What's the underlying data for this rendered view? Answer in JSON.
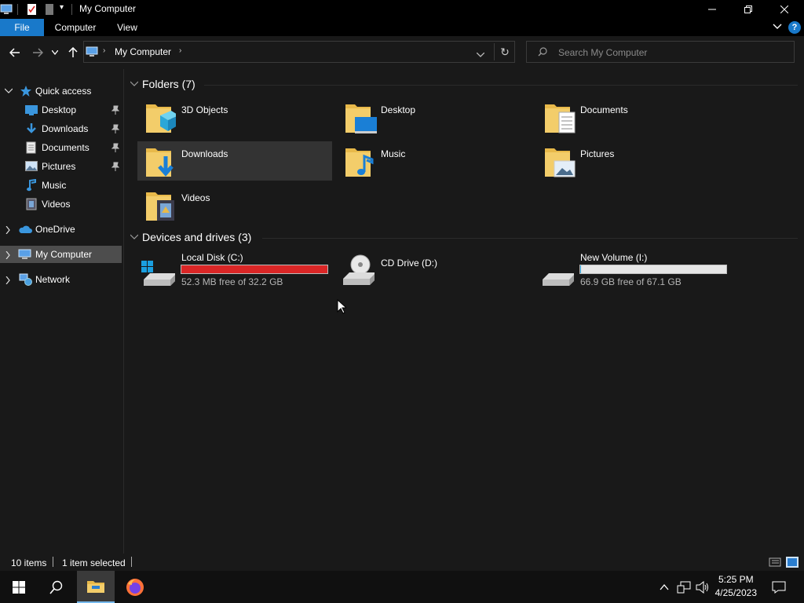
{
  "window": {
    "title": "My Computer"
  },
  "ribbon": {
    "tabs": [
      "File",
      "Computer",
      "View"
    ]
  },
  "address": {
    "path": "My Computer",
    "search_placeholder": "Search My Computer"
  },
  "sidebar": {
    "quick_access": "Quick access",
    "quick_items": [
      {
        "label": "Desktop",
        "pinned": true
      },
      {
        "label": "Downloads",
        "pinned": true
      },
      {
        "label": "Documents",
        "pinned": true
      },
      {
        "label": "Pictures",
        "pinned": true
      },
      {
        "label": "Music",
        "pinned": false
      },
      {
        "label": "Videos",
        "pinned": false
      }
    ],
    "onedrive": "OneDrive",
    "my_computer": "My Computer",
    "network": "Network"
  },
  "main": {
    "folders_header": "Folders (7)",
    "folders": [
      {
        "label": "3D Objects"
      },
      {
        "label": "Desktop"
      },
      {
        "label": "Documents"
      },
      {
        "label": "Downloads"
      },
      {
        "label": "Music"
      },
      {
        "label": "Pictures"
      },
      {
        "label": "Videos"
      }
    ],
    "drives_header": "Devices and drives (3)",
    "drives": [
      {
        "label": "Local Disk (C:)",
        "free": "52.3 MB free of 32.2 GB",
        "used_fraction": 0.998,
        "bar_color": "#da2626"
      },
      {
        "label": "CD Drive (D:)",
        "free": "",
        "used_fraction": null,
        "bar_color": ""
      },
      {
        "label": "New Volume (I:)",
        "free": "66.9 GB free of 67.1 GB",
        "used_fraction": 0.003,
        "bar_color": "#26a0da"
      }
    ]
  },
  "status": {
    "items": "10 items",
    "selected": "1 item selected"
  },
  "taskbar": {
    "time": "5:25 PM",
    "date": "4/25/2023"
  },
  "colors": {
    "accent": "#1979ca",
    "folder": "#e8b94a"
  }
}
